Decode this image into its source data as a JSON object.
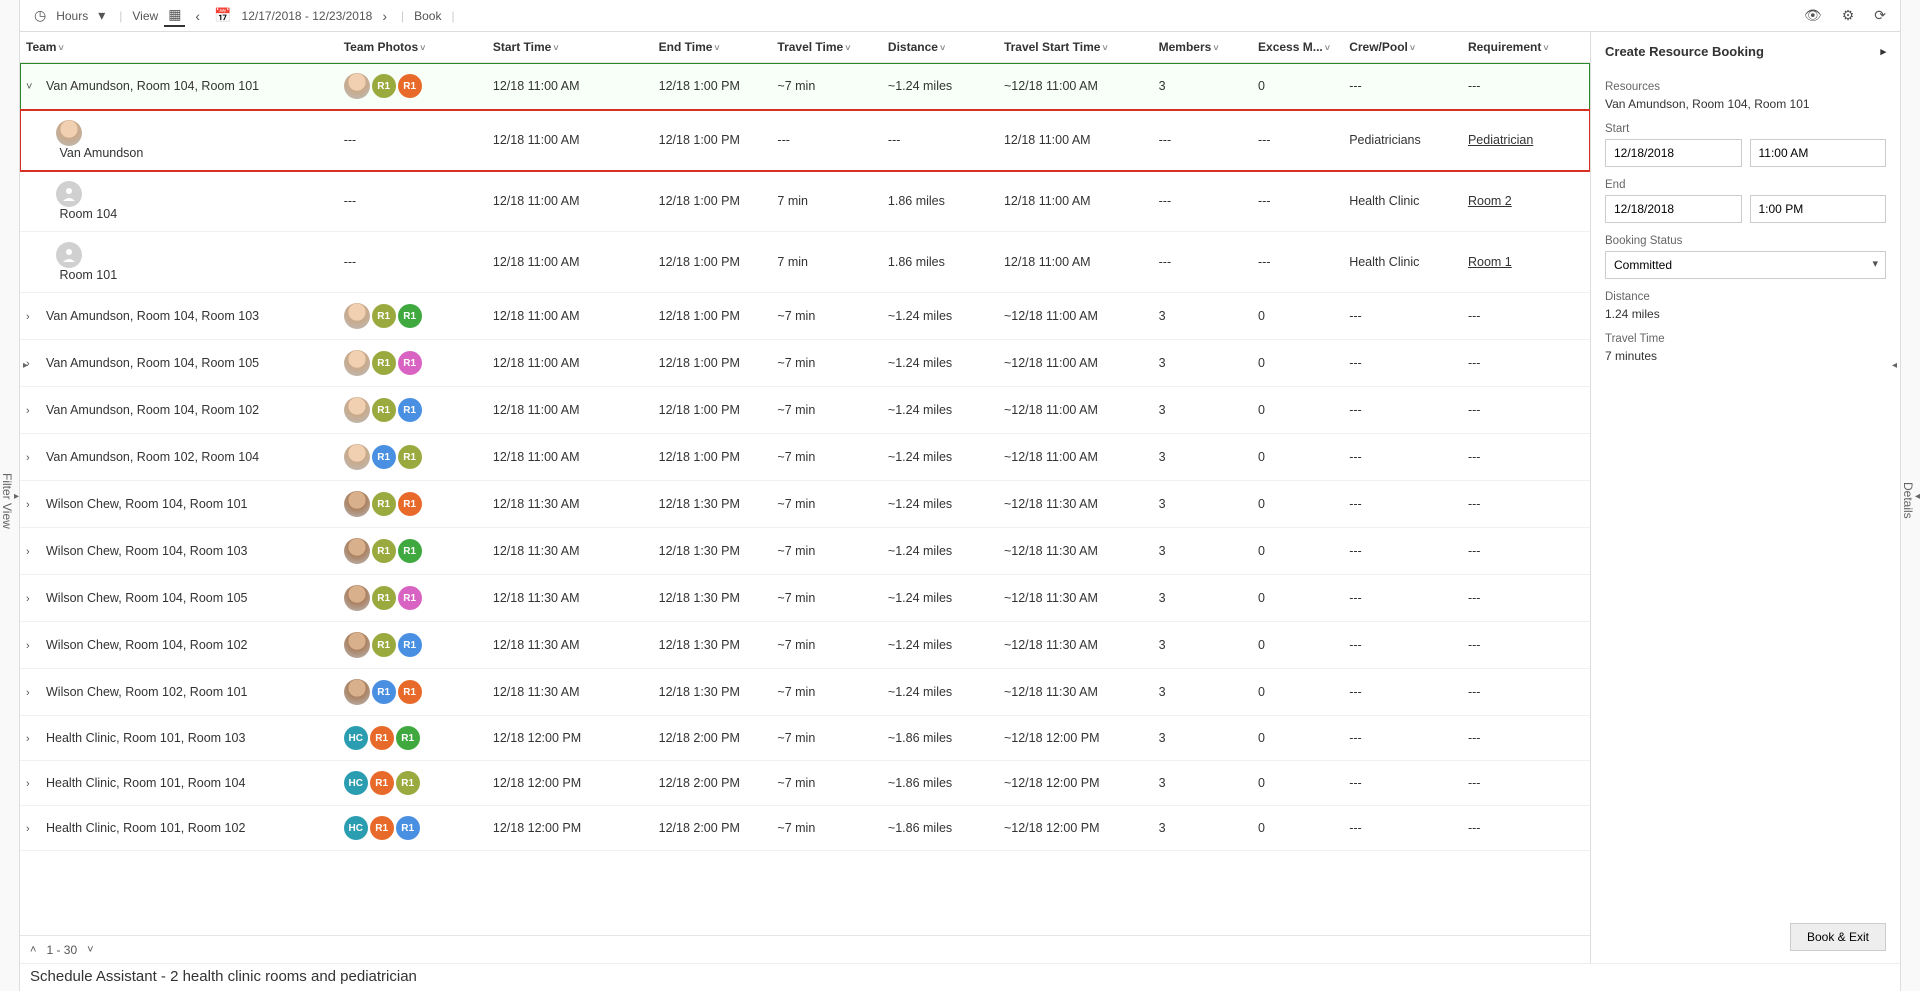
{
  "toolbar": {
    "timeUnit": "Hours",
    "viewLabel": "View",
    "dateRange": "12/17/2018 - 12/23/2018",
    "bookLabel": "Book"
  },
  "sideTabs": {
    "left": "Filter View",
    "right": "Details"
  },
  "columns": [
    "Team",
    "Team Photos",
    "Start Time",
    "End Time",
    "Travel Time",
    "Distance",
    "Travel Start Time",
    "Members",
    "Excess M...",
    "Crew/Pool",
    "Requirement"
  ],
  "rows": [
    {
      "type": "group",
      "expanded": true,
      "selected": true,
      "team": "Van Amundson, Room 104, Room 101",
      "photos": [
        "face",
        "olive:R1",
        "orange:R1"
      ],
      "start": "12/18 11:00 AM",
      "end": "12/18 1:00 PM",
      "travel": "~7 min",
      "dist": "~1.24 miles",
      "tstart": "~12/18 11:00 AM",
      "members": "3",
      "excess": "0",
      "crew": "---",
      "req": "---"
    },
    {
      "type": "child",
      "highlighted": true,
      "team": "Van Amundson",
      "photos": [
        "face-lg"
      ],
      "start": "12/18 11:00 AM",
      "end": "12/18 1:00 PM",
      "travel": "---",
      "dist": "---",
      "tstart": "12/18 11:00 AM",
      "members": "---",
      "excess": "---",
      "crew": "Pediatricians",
      "req": "Pediatrician",
      "reqLink": true,
      "photoCol": "---"
    },
    {
      "type": "child",
      "team": "Room 104",
      "photos": [
        "gray-lg"
      ],
      "start": "12/18 11:00 AM",
      "end": "12/18 1:00 PM",
      "travel": "7 min",
      "dist": "1.86 miles",
      "tstart": "12/18 11:00 AM",
      "members": "---",
      "excess": "---",
      "crew": "Health Clinic",
      "req": "Room 2",
      "reqLink": true,
      "photoCol": "---"
    },
    {
      "type": "child",
      "team": "Room 101",
      "photos": [
        "gray-lg"
      ],
      "start": "12/18 11:00 AM",
      "end": "12/18 1:00 PM",
      "travel": "7 min",
      "dist": "1.86 miles",
      "tstart": "12/18 11:00 AM",
      "members": "---",
      "excess": "---",
      "crew": "Health Clinic",
      "req": "Room 1",
      "reqLink": true,
      "photoCol": "---"
    },
    {
      "type": "group",
      "team": "Van Amundson, Room 104, Room 103",
      "photos": [
        "face",
        "olive:R1",
        "green:R1"
      ],
      "start": "12/18 11:00 AM",
      "end": "12/18 1:00 PM",
      "travel": "~7 min",
      "dist": "~1.24 miles",
      "tstart": "~12/18 11:00 AM",
      "members": "3",
      "excess": "0",
      "crew": "---",
      "req": "---"
    },
    {
      "type": "group",
      "team": "Van Amundson, Room 104, Room 105",
      "photos": [
        "face",
        "olive:R1",
        "pink:R1"
      ],
      "start": "12/18 11:00 AM",
      "end": "12/18 1:00 PM",
      "travel": "~7 min",
      "dist": "~1.24 miles",
      "tstart": "~12/18 11:00 AM",
      "members": "3",
      "excess": "0",
      "crew": "---",
      "req": "---"
    },
    {
      "type": "group",
      "team": "Van Amundson, Room 104, Room 102",
      "photos": [
        "face",
        "olive:R1",
        "blue:R1"
      ],
      "start": "12/18 11:00 AM",
      "end": "12/18 1:00 PM",
      "travel": "~7 min",
      "dist": "~1.24 miles",
      "tstart": "~12/18 11:00 AM",
      "members": "3",
      "excess": "0",
      "crew": "---",
      "req": "---"
    },
    {
      "type": "group",
      "team": "Van Amundson, Room 102, Room 104",
      "photos": [
        "face",
        "blue:R1",
        "olive:R1"
      ],
      "start": "12/18 11:00 AM",
      "end": "12/18 1:00 PM",
      "travel": "~7 min",
      "dist": "~1.24 miles",
      "tstart": "~12/18 11:00 AM",
      "members": "3",
      "excess": "0",
      "crew": "---",
      "req": "---"
    },
    {
      "type": "group",
      "team": "Wilson Chew, Room 104, Room 101",
      "photos": [
        "face2",
        "olive:R1",
        "orange:R1"
      ],
      "start": "12/18 11:30 AM",
      "end": "12/18 1:30 PM",
      "travel": "~7 min",
      "dist": "~1.24 miles",
      "tstart": "~12/18 11:30 AM",
      "members": "3",
      "excess": "0",
      "crew": "---",
      "req": "---"
    },
    {
      "type": "group",
      "team": "Wilson Chew, Room 104, Room 103",
      "photos": [
        "face2",
        "olive:R1",
        "green:R1"
      ],
      "start": "12/18 11:30 AM",
      "end": "12/18 1:30 PM",
      "travel": "~7 min",
      "dist": "~1.24 miles",
      "tstart": "~12/18 11:30 AM",
      "members": "3",
      "excess": "0",
      "crew": "---",
      "req": "---"
    },
    {
      "type": "group",
      "team": "Wilson Chew, Room 104, Room 105",
      "photos": [
        "face2",
        "olive:R1",
        "pink:R1"
      ],
      "start": "12/18 11:30 AM",
      "end": "12/18 1:30 PM",
      "travel": "~7 min",
      "dist": "~1.24 miles",
      "tstart": "~12/18 11:30 AM",
      "members": "3",
      "excess": "0",
      "crew": "---",
      "req": "---"
    },
    {
      "type": "group",
      "team": "Wilson Chew, Room 104, Room 102",
      "photos": [
        "face2",
        "olive:R1",
        "blue:R1"
      ],
      "start": "12/18 11:30 AM",
      "end": "12/18 1:30 PM",
      "travel": "~7 min",
      "dist": "~1.24 miles",
      "tstart": "~12/18 11:30 AM",
      "members": "3",
      "excess": "0",
      "crew": "---",
      "req": "---"
    },
    {
      "type": "group",
      "team": "Wilson Chew, Room 102, Room 101",
      "photos": [
        "face2",
        "blue:R1",
        "orange:R1"
      ],
      "start": "12/18 11:30 AM",
      "end": "12/18 1:30 PM",
      "travel": "~7 min",
      "dist": "~1.24 miles",
      "tstart": "~12/18 11:30 AM",
      "members": "3",
      "excess": "0",
      "crew": "---",
      "req": "---"
    },
    {
      "type": "group",
      "team": "Health Clinic, Room 101, Room 103",
      "photos": [
        "teal:HC",
        "orange:R1",
        "green:R1"
      ],
      "start": "12/18 12:00 PM",
      "end": "12/18 2:00 PM",
      "travel": "~7 min",
      "dist": "~1.86 miles",
      "tstart": "~12/18 12:00 PM",
      "members": "3",
      "excess": "0",
      "crew": "---",
      "req": "---"
    },
    {
      "type": "group",
      "team": "Health Clinic, Room 101, Room 104",
      "photos": [
        "teal:HC",
        "orange:R1",
        "olive:R1"
      ],
      "start": "12/18 12:00 PM",
      "end": "12/18 2:00 PM",
      "travel": "~7 min",
      "dist": "~1.86 miles",
      "tstart": "~12/18 12:00 PM",
      "members": "3",
      "excess": "0",
      "crew": "---",
      "req": "---"
    },
    {
      "type": "group",
      "team": "Health Clinic, Room 101, Room 102",
      "photos": [
        "teal:HC",
        "orange:R1",
        "blue:R1"
      ],
      "start": "12/18 12:00 PM",
      "end": "12/18 2:00 PM",
      "travel": "~7 min",
      "dist": "~1.86 miles",
      "tstart": "~12/18 12:00 PM",
      "members": "3",
      "excess": "0",
      "crew": "---",
      "req": "---"
    }
  ],
  "pager": {
    "range": "1 - 30"
  },
  "details": {
    "title": "Create Resource Booking",
    "resourcesLabel": "Resources",
    "resourcesValue": "Van Amundson, Room 104, Room 101",
    "startLabel": "Start",
    "startDate": "12/18/2018",
    "startTime": "11:00 AM",
    "endLabel": "End",
    "endDate": "12/18/2018",
    "endTime": "1:00 PM",
    "statusLabel": "Booking Status",
    "statusValue": "Committed",
    "distanceLabel": "Distance",
    "distanceValue": "1.24 miles",
    "travelLabel": "Travel Time",
    "travelValue": "7 minutes",
    "bookBtn": "Book & Exit"
  },
  "caption": "Schedule Assistant - 2 health clinic rooms and pediatrician"
}
